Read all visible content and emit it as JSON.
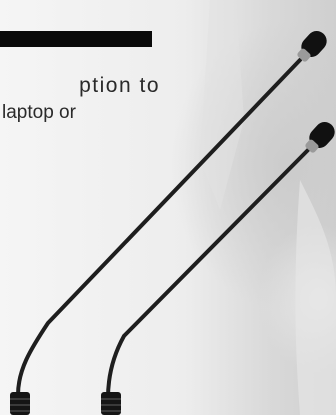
{
  "caption": {
    "line1": "ption to",
    "line2": "laptop or"
  },
  "colors": {
    "background": "#f1f1f1",
    "bar": "#0a0a0a",
    "text": "#2a2a2a",
    "microphone": "#1b1b1b"
  },
  "objects": {
    "microphones": [
      "gooseneck-microphone",
      "gooseneck-microphone"
    ]
  }
}
